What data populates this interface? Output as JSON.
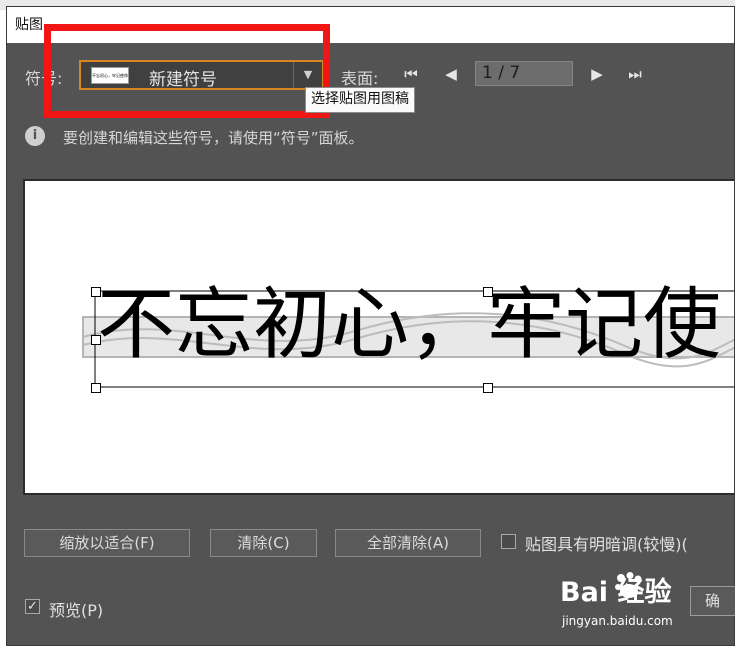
{
  "dialog": {
    "title": "贴图"
  },
  "symbol": {
    "label": "符号:",
    "value": "新建符号",
    "thumbnail_text": "不忘初心，牢记使命",
    "tooltip": "选择贴图用图稿"
  },
  "surface": {
    "label": "表面:",
    "page_value": "1 / 7"
  },
  "info": {
    "text": "要创建和编辑这些符号，请使用“符号”面板。"
  },
  "preview": {
    "text": "不忘初心，牢记使"
  },
  "buttons": {
    "fit": "缩放以适合(F)",
    "clear": "清除(C)",
    "clear_all": "全部清除(A)",
    "ok": "确"
  },
  "options": {
    "shade_label": "贴图具有明暗调(较慢)(",
    "shade_checked": false,
    "preview_label": "预览(P)",
    "preview_checked": true
  },
  "watermark": {
    "logo": "Bai  经验",
    "url": "jingyan.baidu.com"
  },
  "colors": {
    "dialog_bg": "#535353",
    "highlight_box": "#f11616",
    "select_border": "#d5881f"
  }
}
